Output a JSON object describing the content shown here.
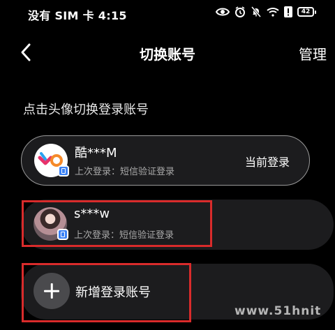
{
  "status_bar": {
    "carrier_time": "没有 SIM 卡 4:15",
    "battery": "42"
  },
  "nav": {
    "title": "切换账号",
    "manage_label": "管理"
  },
  "hint": "点击头像切换登录账号",
  "accounts": [
    {
      "name": "酷***M",
      "last_login": "上次登录：短信验证登录",
      "status": "当前登录"
    },
    {
      "name": "s***w",
      "last_login": "上次登录：短信验证登录"
    }
  ],
  "add_account_label": "新增登录账号",
  "highlight_color": "#d92b2b",
  "watermark": "www.51hnit"
}
